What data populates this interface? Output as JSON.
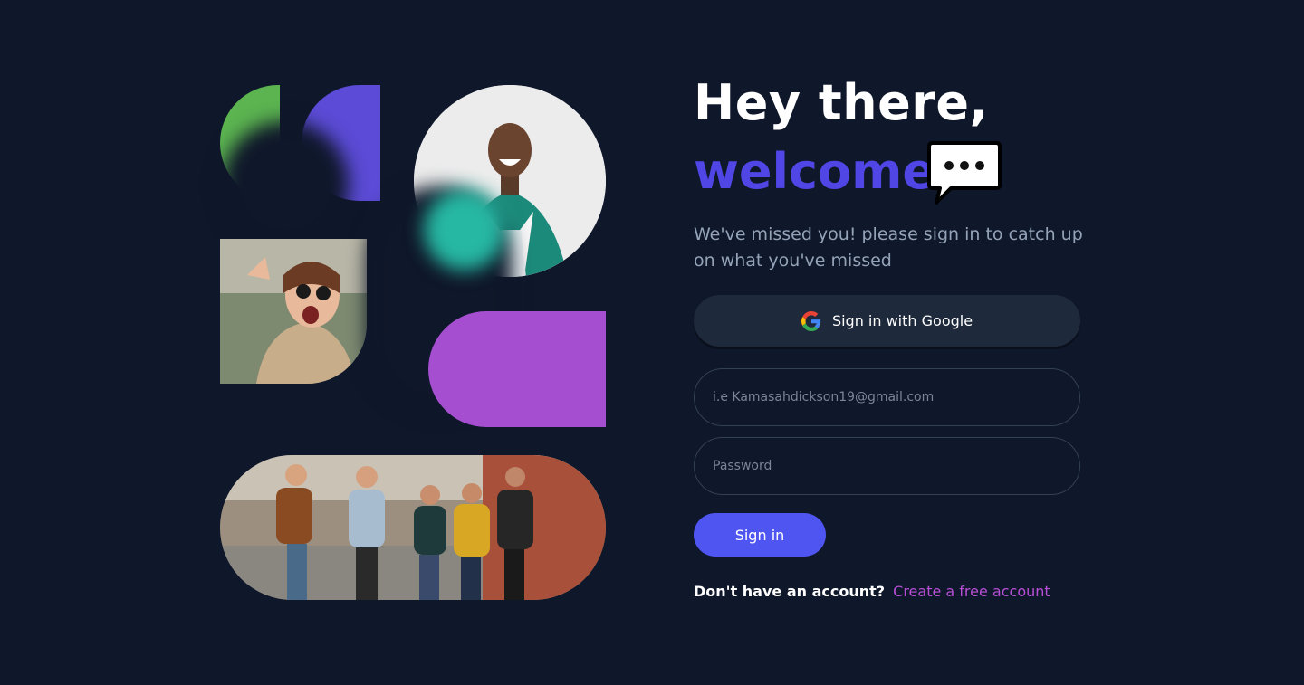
{
  "heading": {
    "line1": "Hey there,",
    "line2": "welcome"
  },
  "subtitle": "We've missed you! please sign in to catch up on what you've missed",
  "google_button": {
    "label": "Sign in with Google",
    "icon": "google-icon"
  },
  "form": {
    "email_placeholder": "i.e Kamasahdickson19@gmail.com",
    "password_placeholder": "Password",
    "submit_label": "Sign in"
  },
  "signup": {
    "prompt": "Don't have an account?",
    "link_label": "Create a free account"
  },
  "icons": {
    "chat": "chat-bubble-icon"
  },
  "colors": {
    "background": "#0f172a",
    "accent": "#4f46e5",
    "button": "#4f55f0",
    "link": "#b84fd6",
    "green": "#5bb450",
    "purple": "#5b4bd6",
    "magenta": "#a54fd0",
    "teal": "#26b8a3"
  }
}
